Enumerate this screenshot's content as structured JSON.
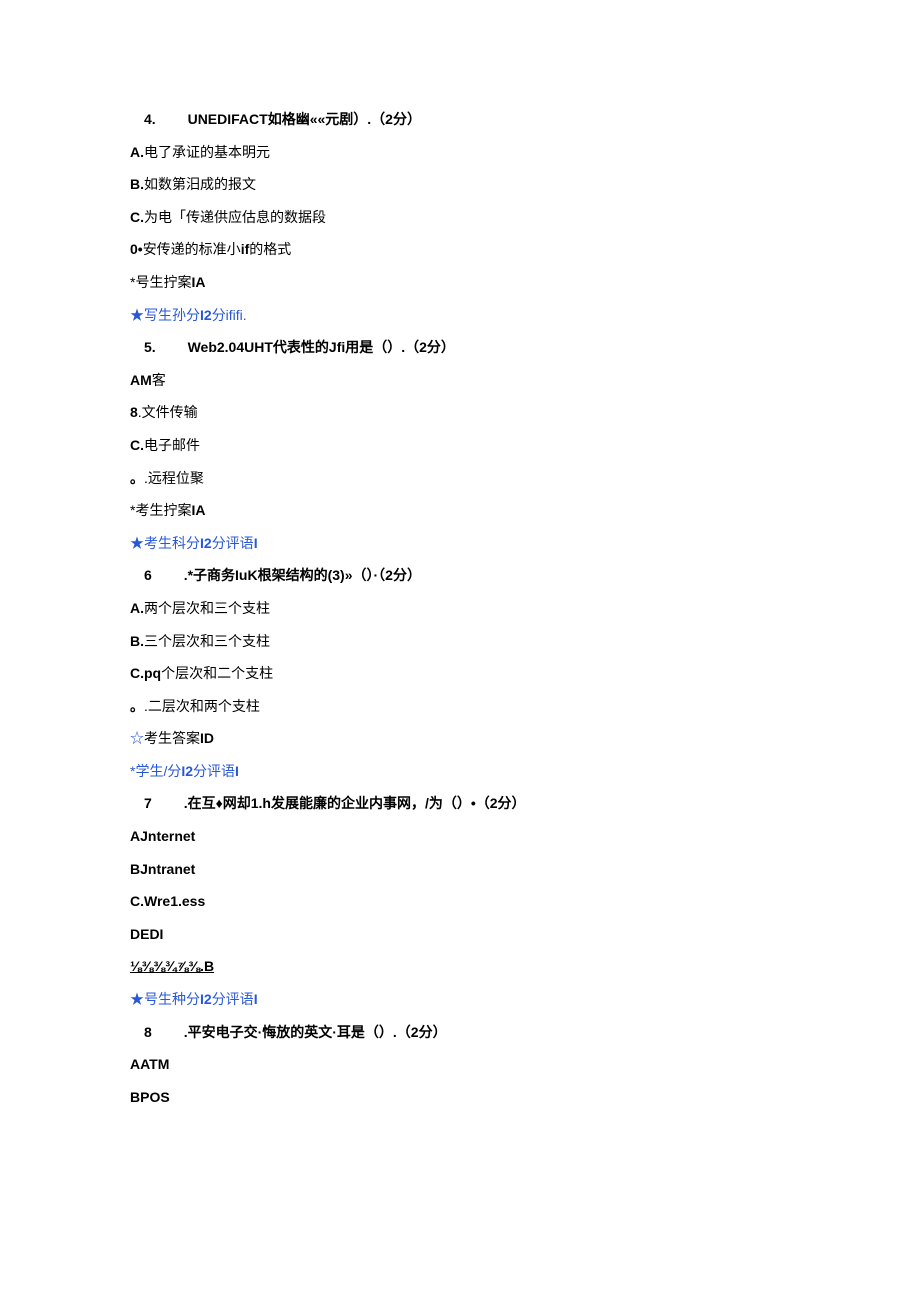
{
  "q4": {
    "num": "4.",
    "stem_bold": "UNEDIFACT",
    "stem_rest": "如格幽««元剧）.（2分）",
    "opts": {
      "A": {
        "label": "A.",
        "text": "电了承证的基本明元"
      },
      "B": {
        "label": "B.",
        "text": "如数第汨成的报文"
      },
      "C": {
        "label": "C.",
        "text": "为电「传递供应估息的数据段"
      },
      "D": {
        "label": "0•",
        "text": "安传递的标准小",
        "text_bold": "if",
        "text_tail": "的格式"
      }
    },
    "ans_prefix": "*号生拧案",
    "ans_bold": "IA",
    "score_star": "★",
    "score_text": "写生孙分",
    "score_bold": "I2",
    "score_tail": "分ififi."
  },
  "q5": {
    "num": "5.",
    "stem_bold": "Web2.04UHT",
    "stem_rest": "代表性的",
    "stem_bold2": "Jfi",
    "stem_rest2": "用是（）.（2分）",
    "opts": {
      "A": {
        "label": "AM",
        "text": "客"
      },
      "B": {
        "label": "8",
        "text": ".文件传输"
      },
      "C": {
        "label": "C.",
        "text": "电子邮件"
      },
      "D": {
        "label": "。",
        "text": ".远程位聚"
      }
    },
    "ans_prefix": "*考生拧案",
    "ans_bold": "IA",
    "score_star": "★",
    "score_text": "考生科分",
    "score_bold": "I2",
    "score_tail": "分评语",
    "score_tail_bold": "I"
  },
  "q6": {
    "num": "6",
    "stem_lead": " .*子商务",
    "stem_bold": "IuK",
    "stem_rest": "根架结构的(3)»（）·（2分）",
    "opts": {
      "A": {
        "label": "A.",
        "text": "两个层次和三个支柱"
      },
      "B": {
        "label": "B.",
        "text": "三个层次和三个支柱"
      },
      "C": {
        "label": "C.pq",
        "text": "个层次和二个支柱"
      },
      "D": {
        "label": "。",
        "text": ".二层次和两个支柱"
      }
    },
    "ans_star": "☆",
    "ans_prefix": "考生答案",
    "ans_bold": "ID",
    "score_star": "*",
    "score_text": "学生/分",
    "score_bold": "I2",
    "score_tail": "分评语",
    "score_tail_bold": "I"
  },
  "q7": {
    "num": "7",
    "stem_lead": " .在互♦网却",
    "stem_bold": "1.h",
    "stem_rest": "发展能廉的企业内事网，/为（）•（2分）",
    "opts": {
      "A": {
        "label": "AJnternet"
      },
      "B": {
        "label": "BJntranet"
      },
      "C": {
        "label": "C.Wre1.ess"
      },
      "D": {
        "label": "DEDI"
      }
    },
    "ans_under": "⅛⅜⅜¾⅞⅜.B",
    "score_star": "★",
    "score_text": "号生种分",
    "score_bold": "I2",
    "score_tail": "分评语",
    "score_tail_bold": "I"
  },
  "q8": {
    "num": "8",
    "stem": " .平安电子交·悔放的英文·耳是（）.（2分）",
    "opts": {
      "A": {
        "label": "AATM"
      },
      "B": {
        "label": "BPOS"
      }
    }
  }
}
